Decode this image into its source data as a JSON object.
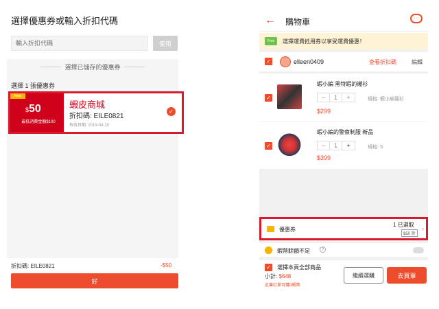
{
  "left": {
    "title": "選擇優惠券或輸入折扣代碼",
    "input_placeholder": "輸入折扣代碼",
    "apply_label": "使用",
    "saved_label": "選擇已儲存的優惠券",
    "choose_count": "選擇 1 張優惠券",
    "coupon": {
      "new_badge": "New",
      "currency": "$",
      "amount": "50",
      "min_spend": "最低消費金額$100",
      "name": "蝦皮商城",
      "code": "折扣碼: EILE0821",
      "valid": "有效日期: 2019-09-20",
      "check": "✓"
    },
    "code_summary": "折扣碼: EILE0821",
    "discount": "-$50",
    "ok_label": "好"
  },
  "right": {
    "title": "購物車",
    "back_icon": "←",
    "banner_badge": "Free",
    "banner_text": "選擇運費抵用券以享受運費優惠！",
    "shop": {
      "name": "elleen0409",
      "voucher_link": "查看折扣碼",
      "edit_label": "編輯"
    },
    "items": [
      {
        "name": "蝦小編 黑特蝦的襯衫",
        "qty": "1",
        "spec": "規格: 蝦小編襯衫",
        "price": "$299"
      },
      {
        "name": "蝦小編的警察制服 新品",
        "qty": "1",
        "spec": "規格: S",
        "price": "$399"
      }
    ],
    "voucher": {
      "label": "優惠券",
      "selected": "1 已選取",
      "badge": "$50 折",
      "arrow": "›"
    },
    "coins_text": "蝦幣餘額不足",
    "bottom": {
      "select_all": "選擇本頁全部商品",
      "subtotal_label": "小計: ",
      "subtotal_amount": "$648",
      "earn_text": "此筆訂單可獲0蝦幣",
      "continue_label": "繼續選購",
      "checkout_label": "去買單"
    }
  },
  "colors": {
    "accent": "#ee4d2d",
    "coupon_red": "#d0011b",
    "highlight_border": "#d81b2b"
  }
}
